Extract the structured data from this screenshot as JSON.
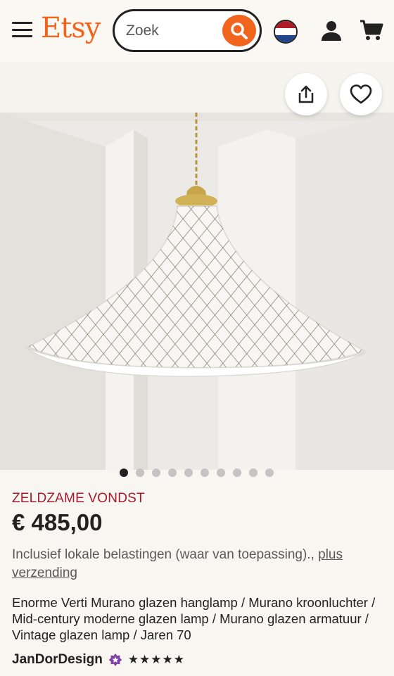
{
  "header": {
    "logo": "Etsy",
    "search_placeholder": "Zoek",
    "icons": [
      "menu-icon",
      "search-icon",
      "flag-nl-icon",
      "user-icon",
      "cart-icon"
    ]
  },
  "gallery": {
    "image_count": 10,
    "active_index": 0,
    "icons": [
      "share-icon",
      "heart-icon"
    ]
  },
  "listing": {
    "badge": "ZELDZAME VONDST",
    "price": "€ 485,00",
    "tax_text": "Inclusief lokale belastingen (waar van toepassing).,",
    "shipping_link": "plus verzending",
    "title": "Enorme Verti Murano glazen hanglamp / Murano kroonluchter / Mid-century moderne glazen lamp / Murano glazen armatuur / Vintage glazen lamp / Jaren 70",
    "seller": "JanDorDesign",
    "rating_stars": "★★★★★",
    "rating": 5
  },
  "colors": {
    "brand": "#f1641e",
    "badge": "#a61a2e",
    "flag": [
      "#ae1c28",
      "#ffffff",
      "#21468b"
    ]
  }
}
